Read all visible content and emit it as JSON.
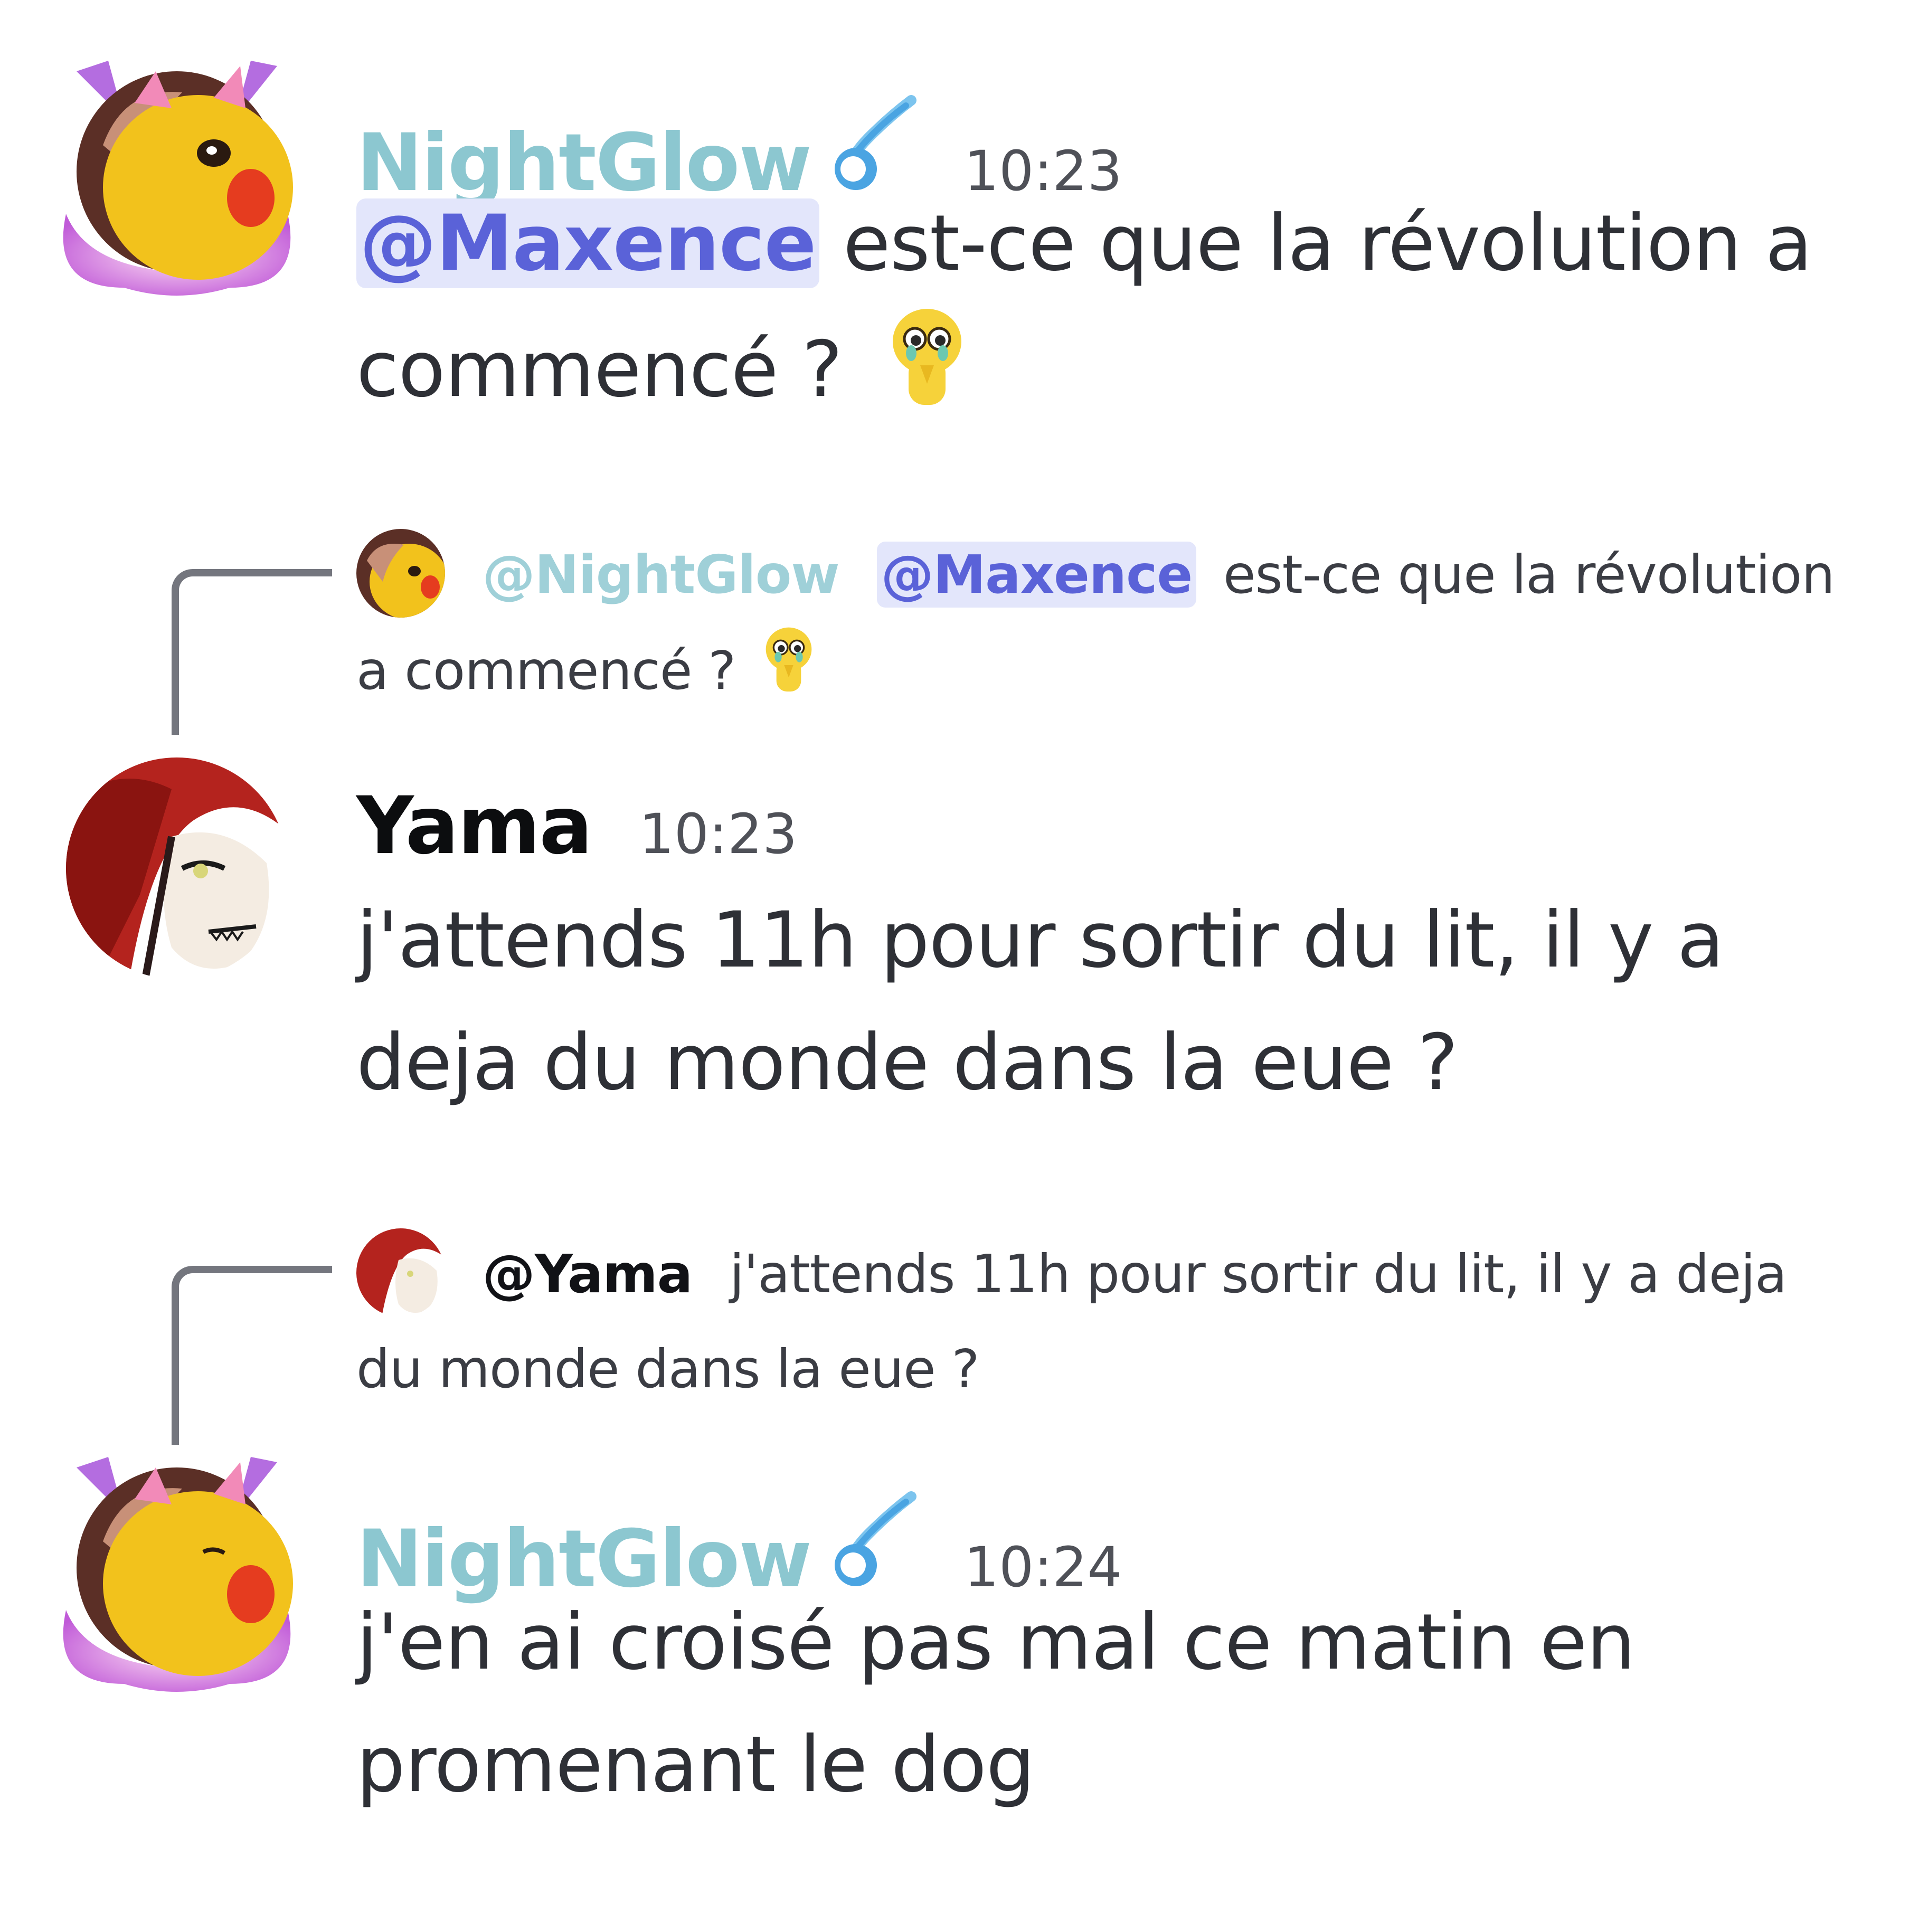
{
  "messages": [
    {
      "author": "NightGlow",
      "author_color": "#8cc7d0",
      "timestamp": "10:23",
      "mention": "@Maxence",
      "text": "est-ce que la révolution a commencé ?",
      "emoji": "pleading-face-emoji"
    },
    {
      "reply_to": {
        "author": "@NightGlow",
        "mention": "@Maxence",
        "text": "est-ce que la révolution a commencé ?",
        "emoji": "pleading-face-emoji"
      },
      "author": "Yama",
      "author_color": "#0c0d0f",
      "timestamp": "10:23",
      "text": "j'attends 11h pour sortir du lit, il y a deja du monde dans la eue ?"
    },
    {
      "reply_to": {
        "author": "@Yama",
        "text": "j'attends 11h pour sortir du lit, il y a deja du monde dans la eue ?"
      },
      "author": "NightGlow",
      "author_color": "#8cc7d0",
      "timestamp": "10:24",
      "text": "j'en ai croisé pas mal ce matin en promenant le dog"
    }
  ],
  "colors": {
    "mention_bg": "#e3e6fb",
    "mention_text": "#5a62d8",
    "reply_line": "#74767e",
    "badge": "#6ab4e6"
  }
}
